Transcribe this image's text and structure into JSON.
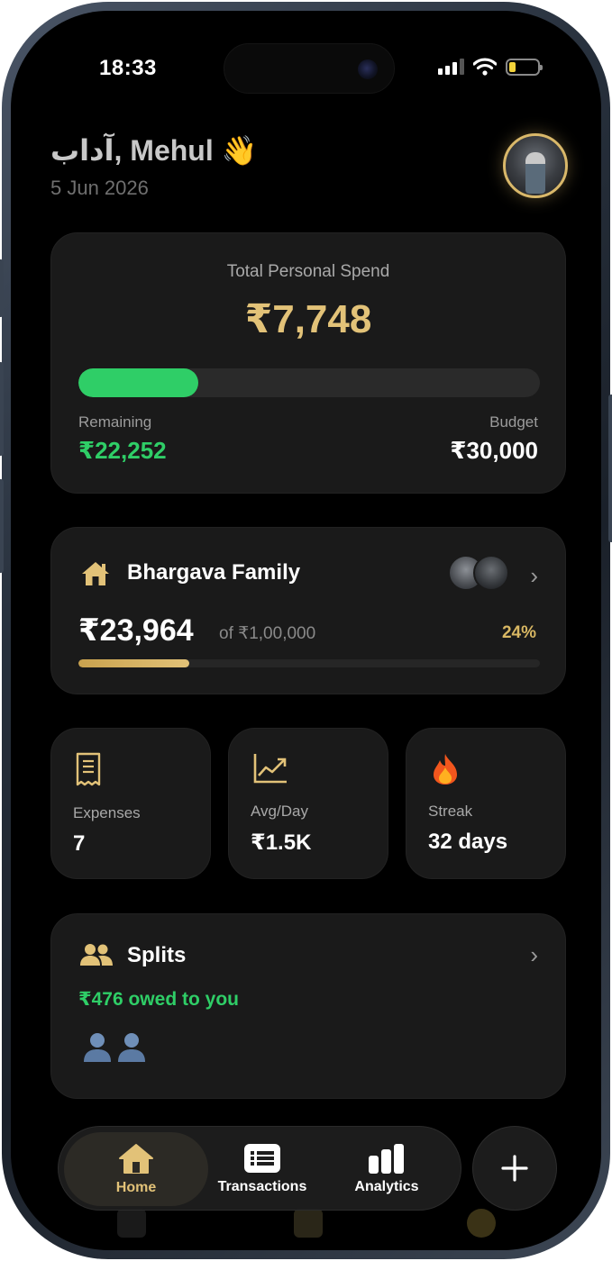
{
  "status": {
    "time": "18:33"
  },
  "header": {
    "greeting": "آداب, Mehul 👋",
    "date": "5 Jun 2026"
  },
  "spend": {
    "title": "Total Personal Spend",
    "amount": "₹7,748",
    "progress_fraction": 0.26,
    "remaining_label": "Remaining",
    "remaining_value": "₹22,252",
    "budget_label": "Budget",
    "budget_value": "₹30,000"
  },
  "family": {
    "name": "Bhargava Family",
    "amount": "₹23,964",
    "of_text": "of ₹1,00,000",
    "percent": "24%",
    "progress_fraction": 0.24
  },
  "stats": [
    {
      "label": "Expenses",
      "value": "7",
      "icon": "receipt-icon"
    },
    {
      "label": "Avg/Day",
      "value": "₹1.5K",
      "icon": "trend-chart-icon"
    },
    {
      "label": "Streak",
      "value": "32 days",
      "icon": "fire-icon"
    }
  ],
  "splits": {
    "title": "Splits",
    "owed": "₹476 owed to you"
  },
  "tabs": [
    {
      "label": "Home",
      "icon": "home-icon",
      "active": true
    },
    {
      "label": "Transactions",
      "icon": "list-icon",
      "active": false
    },
    {
      "label": "Analytics",
      "icon": "bar-chart-icon",
      "active": false
    }
  ],
  "colors": {
    "accent_gold": "#e2c278",
    "positive_green": "#2fce67",
    "card_bg": "#1a1a1a",
    "screen_bg": "#000000"
  }
}
